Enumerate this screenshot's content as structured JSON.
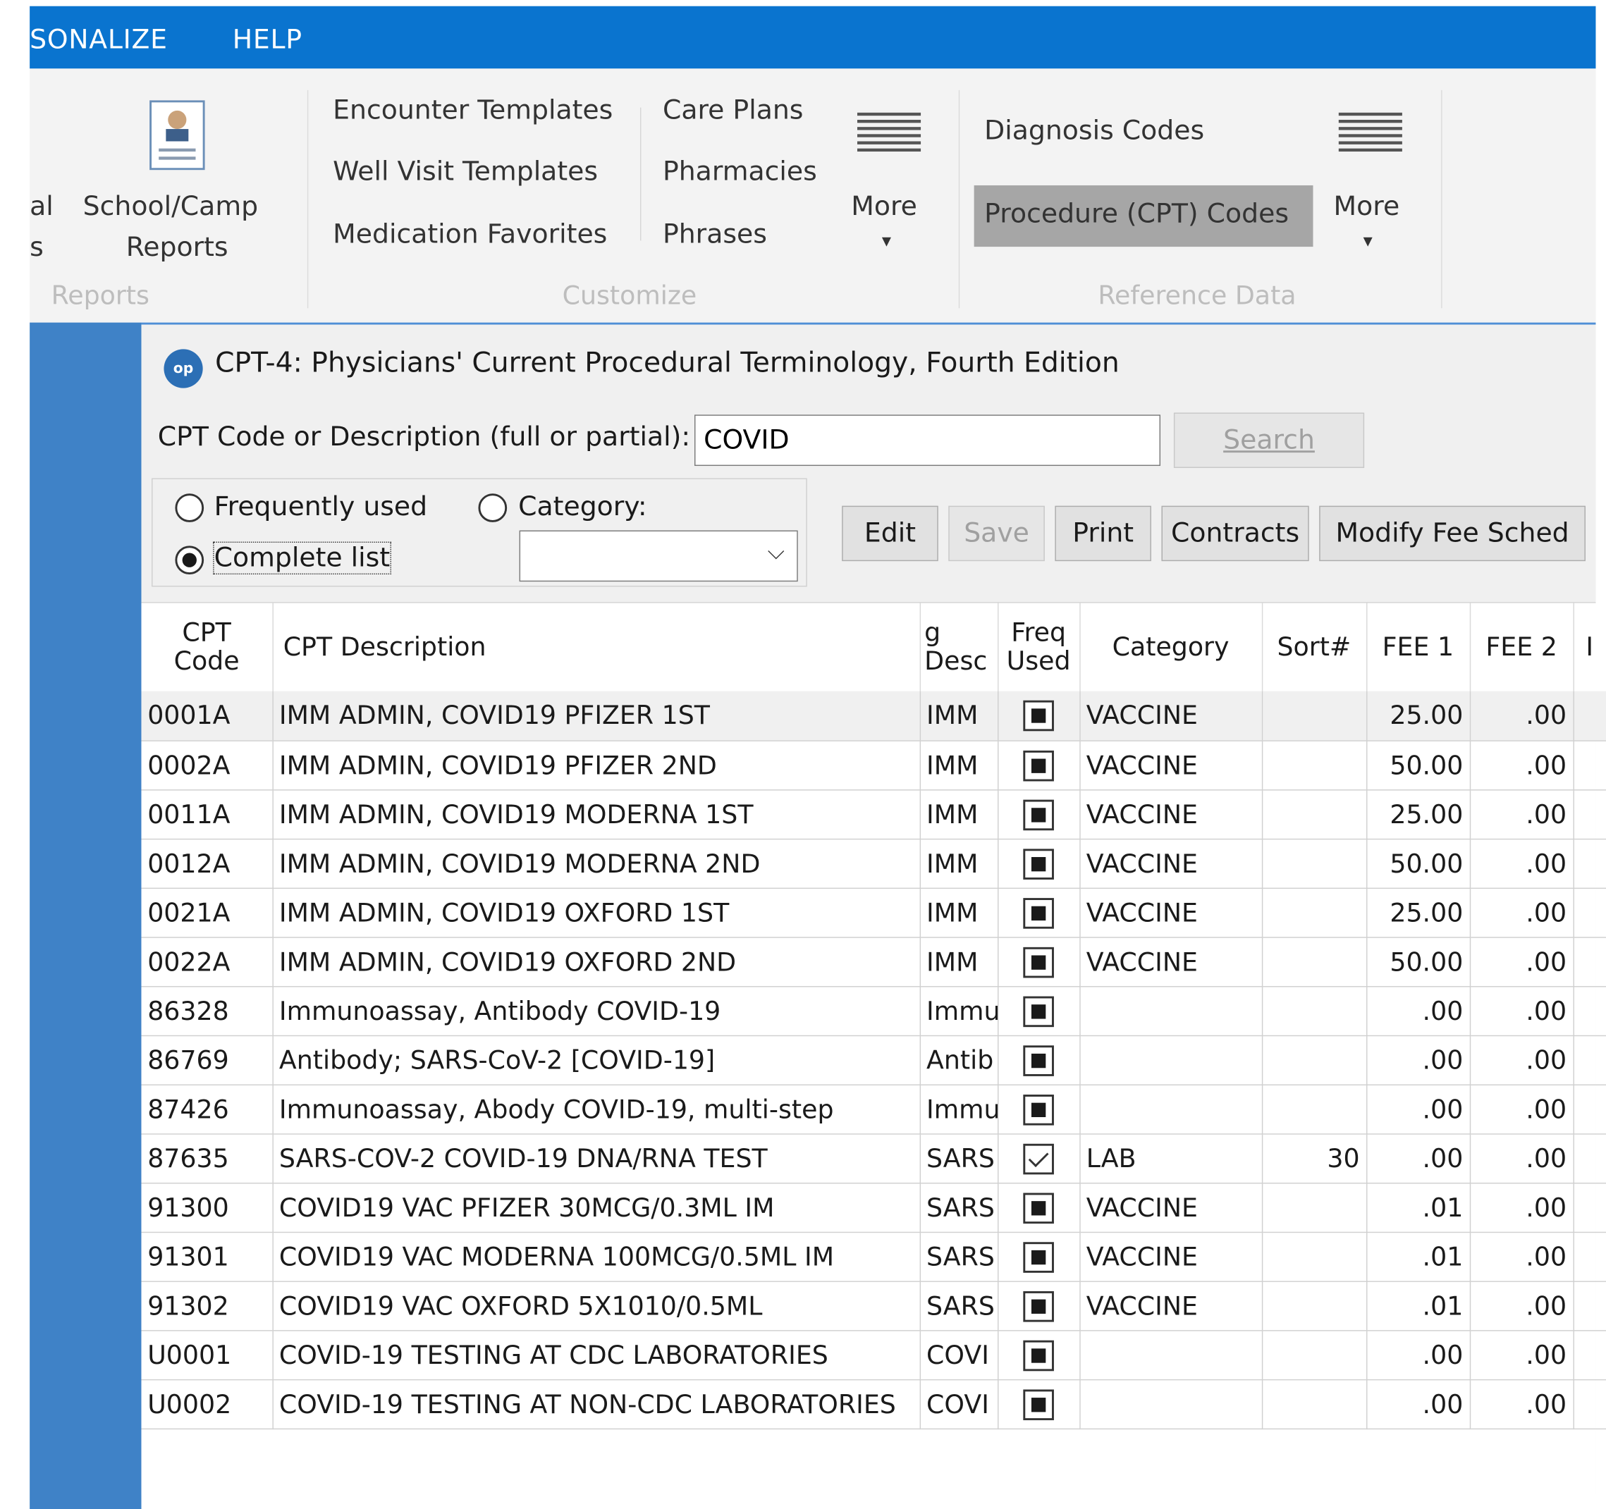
{
  "menubar": {
    "personalize": "SONALIZE",
    "help": "HELP"
  },
  "ribbon": {
    "left_cut_line1": "al",
    "left_cut_line2": "s",
    "school_camp_line1": "School/Camp",
    "school_camp_line2": "Reports",
    "group_reports": "Reports",
    "customize_items": [
      "Encounter Templates",
      "Well Visit Templates",
      "Medication Favorites"
    ],
    "customize_items2": [
      "Care Plans",
      "Pharmacies",
      "Phrases"
    ],
    "more_label": "More",
    "group_customize": "Customize",
    "diagnosis_codes": "Diagnosis Codes",
    "procedure_codes": "Procedure (CPT) Codes",
    "more2_label": "More",
    "group_reference": "Reference Data"
  },
  "dialog": {
    "logo_text": "op",
    "title": "CPT-4:  Physicians' Current Procedural Terminology, Fourth Edition",
    "search_label": "CPT Code or Description (full or partial):",
    "search_value": "COVID",
    "search_button": "Search",
    "radio_frequent": "Frequently used",
    "radio_category": "Category:",
    "radio_complete": "Complete list",
    "category_value": "",
    "buttons": {
      "edit": "Edit",
      "save": "Save",
      "print": "Print",
      "contracts": "Contracts",
      "modify": "Modify Fee Sched"
    }
  },
  "table": {
    "headers": {
      "code_line1": "CPT",
      "code_line2": "Code",
      "desc": "CPT Description",
      "sdesc_line1": "g",
      "sdesc_line2": "Desc",
      "freq_line1": "Freq",
      "freq_line2": "Used",
      "category": "Category",
      "sort": "Sort#",
      "fee1": "FEE 1",
      "fee2": "FEE 2",
      "next": "I"
    },
    "rows": [
      {
        "code": "0001A",
        "desc": "IMM ADMIN, COVID19 PFIZER 1ST",
        "sdesc": "IMM",
        "freq": "filled",
        "category": "VACCINE",
        "sort": "",
        "fee1": "25.00",
        "fee2": ".00"
      },
      {
        "code": "0002A",
        "desc": "IMM ADMIN, COVID19 PFIZER 2ND",
        "sdesc": "IMM",
        "freq": "filled",
        "category": "VACCINE",
        "sort": "",
        "fee1": "50.00",
        "fee2": ".00"
      },
      {
        "code": "0011A",
        "desc": "IMM ADMIN, COVID19 MODERNA 1ST",
        "sdesc": "IMM",
        "freq": "filled",
        "category": "VACCINE",
        "sort": "",
        "fee1": "25.00",
        "fee2": ".00"
      },
      {
        "code": "0012A",
        "desc": "IMM ADMIN, COVID19 MODERNA 2ND",
        "sdesc": "IMM",
        "freq": "filled",
        "category": "VACCINE",
        "sort": "",
        "fee1": "50.00",
        "fee2": ".00"
      },
      {
        "code": "0021A",
        "desc": "IMM ADMIN, COVID19 OXFORD 1ST",
        "sdesc": "IMM",
        "freq": "filled",
        "category": "VACCINE",
        "sort": "",
        "fee1": "25.00",
        "fee2": ".00"
      },
      {
        "code": "0022A",
        "desc": "IMM ADMIN, COVID19 OXFORD 2ND",
        "sdesc": "IMM",
        "freq": "filled",
        "category": "VACCINE",
        "sort": "",
        "fee1": "50.00",
        "fee2": ".00"
      },
      {
        "code": "86328",
        "desc": "Immunoassay, Antibody COVID-19",
        "sdesc": "Immu",
        "freq": "filled",
        "category": "",
        "sort": "",
        "fee1": ".00",
        "fee2": ".00"
      },
      {
        "code": "86769",
        "desc": "Antibody; SARS-CoV-2 [COVID-19]",
        "sdesc": "Antib",
        "freq": "filled",
        "category": "",
        "sort": "",
        "fee1": ".00",
        "fee2": ".00"
      },
      {
        "code": "87426",
        "desc": "Immunoassay, Abody COVID-19, multi-step",
        "sdesc": "Immu",
        "freq": "filled",
        "category": "",
        "sort": "",
        "fee1": ".00",
        "fee2": ".00"
      },
      {
        "code": "87635",
        "desc": "SARS-COV-2 COVID-19 DNA/RNA TEST",
        "sdesc": "SARS",
        "freq": "checked",
        "category": "LAB",
        "sort": "30",
        "fee1": ".00",
        "fee2": ".00"
      },
      {
        "code": "91300",
        "desc": "COVID19 VAC PFIZER 30MCG/0.3ML IM",
        "sdesc": "SARS",
        "freq": "filled",
        "category": "VACCINE",
        "sort": "",
        "fee1": ".01",
        "fee2": ".00"
      },
      {
        "code": "91301",
        "desc": "COVID19 VAC MODERNA 100MCG/0.5ML IM",
        "sdesc": "SARS",
        "freq": "filled",
        "category": "VACCINE",
        "sort": "",
        "fee1": ".01",
        "fee2": ".00"
      },
      {
        "code": "91302",
        "desc": "COVID19 VAC OXFORD 5X1010/0.5ML",
        "sdesc": "SARS",
        "freq": "filled",
        "category": "VACCINE",
        "sort": "",
        "fee1": ".01",
        "fee2": ".00"
      },
      {
        "code": "U0001",
        "desc": "COVID-19 TESTING AT CDC LABORATORIES",
        "sdesc": "COVI",
        "freq": "filled",
        "category": "",
        "sort": "",
        "fee1": ".00",
        "fee2": ".00"
      },
      {
        "code": "U0002",
        "desc": "COVID-19 TESTING AT NON-CDC LABORATORIES",
        "sdesc": "COVI",
        "freq": "filled",
        "category": "",
        "sort": "",
        "fee1": ".00",
        "fee2": ".00"
      }
    ]
  },
  "colors": {
    "menubar": "#0a74cf",
    "left_panel": "#3f82c7",
    "highlight": "#a6a6a6"
  }
}
